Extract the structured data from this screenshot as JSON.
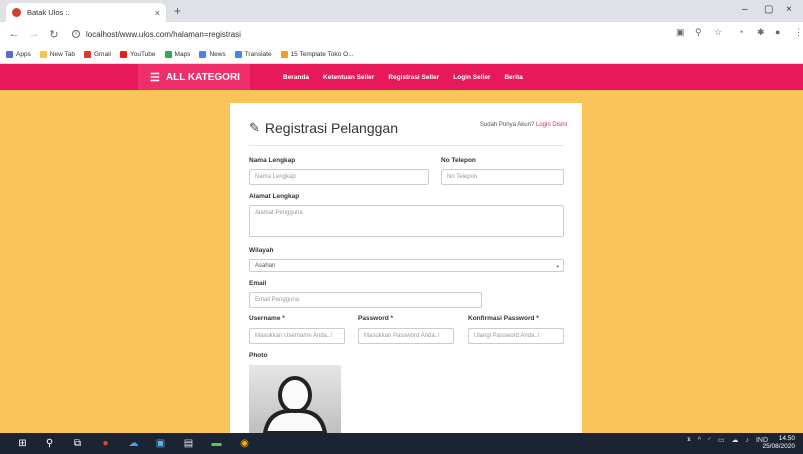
{
  "browser": {
    "tab_title": "Batak Ulos :.",
    "tab_close": "×",
    "new_tab": "+",
    "url": "localhost/www.ulos.com/halaman=registrasi",
    "window_controls": [
      "–",
      "▢",
      "×"
    ],
    "bookmarks": [
      {
        "label": "Apps",
        "color": "#5a6bd6"
      },
      {
        "label": "New Tab",
        "color": "#f0c64e"
      },
      {
        "label": "Gmail",
        "color": "#d9382b"
      },
      {
        "label": "YouTube",
        "color": "#e62117"
      },
      {
        "label": "Maps",
        "color": "#34a853"
      },
      {
        "label": "News",
        "color": "#4285f4"
      },
      {
        "label": "Translate",
        "color": "#4285f4"
      },
      {
        "label": "15 Template Toko O...",
        "color": "#f0a020"
      }
    ]
  },
  "site_nav": {
    "kategori_label": "ALL KATEGORI",
    "links": [
      "Beranda",
      "Ketentuan Seller",
      "Registrasi Seller",
      "Login Seller",
      "Berita"
    ]
  },
  "form": {
    "title": "Registrasi Pelanggan",
    "login_prompt": "Sudah Punya Akun?",
    "login_link": "Login Disini",
    "nama_label": "Nama Lengkap",
    "nama_placeholder": "Nama Lengkap",
    "telepon_label": "No Telepon",
    "telepon_placeholder": "No Telepon",
    "alamat_label": "Alamat Lengkap",
    "alamat_placeholder": "Alamat Pengguna",
    "wilayah_label": "Wilayah",
    "wilayah_value": "Asahan",
    "email_label": "Email",
    "email_placeholder": "Email Pengguna",
    "username_label": "Username *",
    "username_placeholder": "Masukkan Username Anda..!",
    "password_label": "Password *",
    "password_placeholder": "Masukkan Password Anda..!",
    "konfirmasi_label": "Konfirmasi Password *",
    "konfirmasi_placeholder": "Ulangi Password Anda..!",
    "photo_label": "Photo"
  },
  "taskbar": {
    "lang": "IND",
    "time": "14.50",
    "date": "25/08/2020"
  },
  "colors": {
    "page_bg": "#f9c55a",
    "nav_bg": "#e8195a",
    "accent": "#e8195a"
  }
}
